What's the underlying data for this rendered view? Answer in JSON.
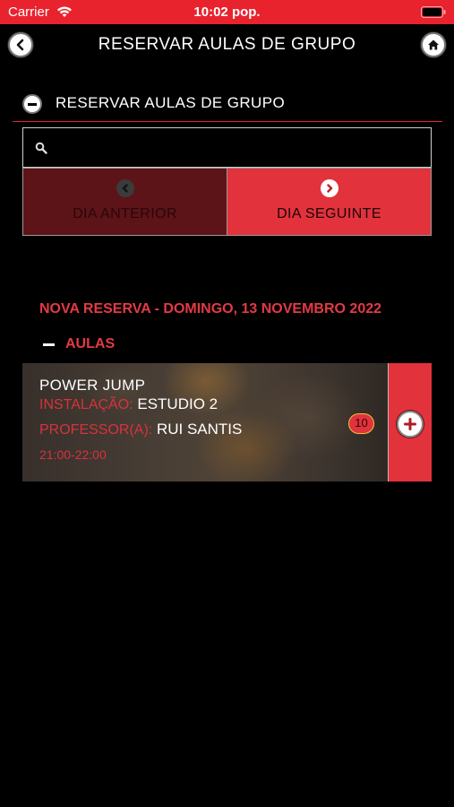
{
  "status_bar": {
    "carrier": "Carrier",
    "time": "10:02 pop.",
    "background": "#e8232e"
  },
  "nav": {
    "title": "RESERVAR AULAS DE GRUPO",
    "back_icon": "chevron-left-icon",
    "home_icon": "home-icon"
  },
  "section": {
    "title": "RESERVAR AULAS DE GRUPO",
    "collapse_icon": "minus-circle-icon"
  },
  "search": {
    "value": "",
    "placeholder": "",
    "icon": "search-icon"
  },
  "day_nav": {
    "previous_label": "DIA ANTERIOR",
    "next_label": "DIA SEGUINTE",
    "previous_icon": "chevron-left-icon",
    "next_icon": "chevron-right-icon"
  },
  "booking": {
    "title": "NOVA RESERVA - DOMINGO, 13 NOVEMBRO 2022",
    "group_label": "AULAS",
    "classes": [
      {
        "name": "POWER JUMP",
        "venue_label": "INSTALAÇÃO:",
        "venue": "ESTUDIO 2",
        "teacher_label": "PROFESSOR(A):",
        "teacher": "RUI SANTIS",
        "time": "21:00-22:00",
        "spots": "10",
        "add_icon": "plus-circle-icon"
      }
    ]
  },
  "colors": {
    "accent": "#e2323c",
    "accent_dark": "#5c1418",
    "text_red": "#e33a44"
  }
}
